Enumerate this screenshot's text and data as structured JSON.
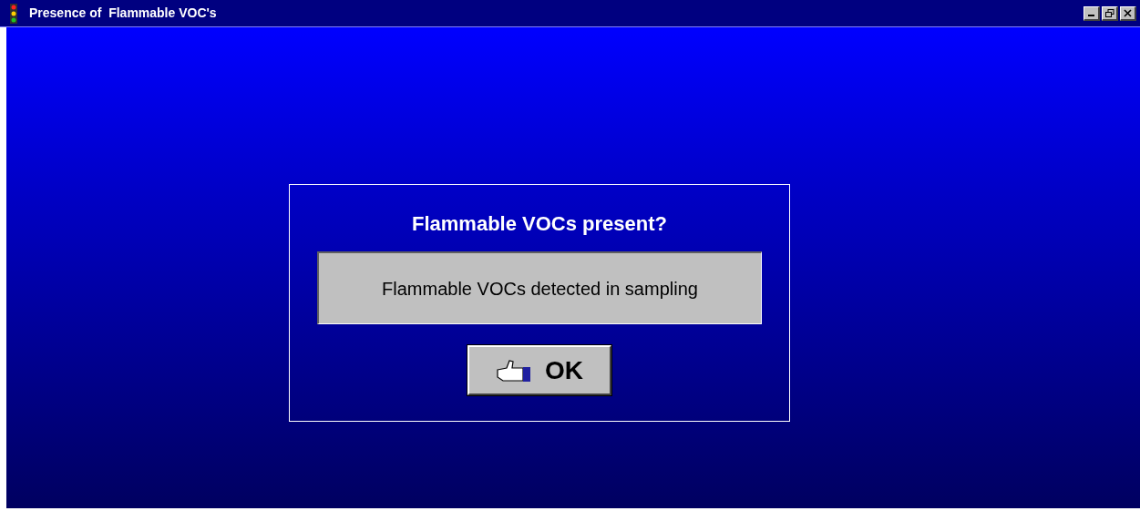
{
  "window": {
    "title": "Presence of  Flammable VOC's"
  },
  "dialog": {
    "heading": "Flammable VOCs present?",
    "message": "Flammable VOCs detected in sampling",
    "button": "OK"
  }
}
